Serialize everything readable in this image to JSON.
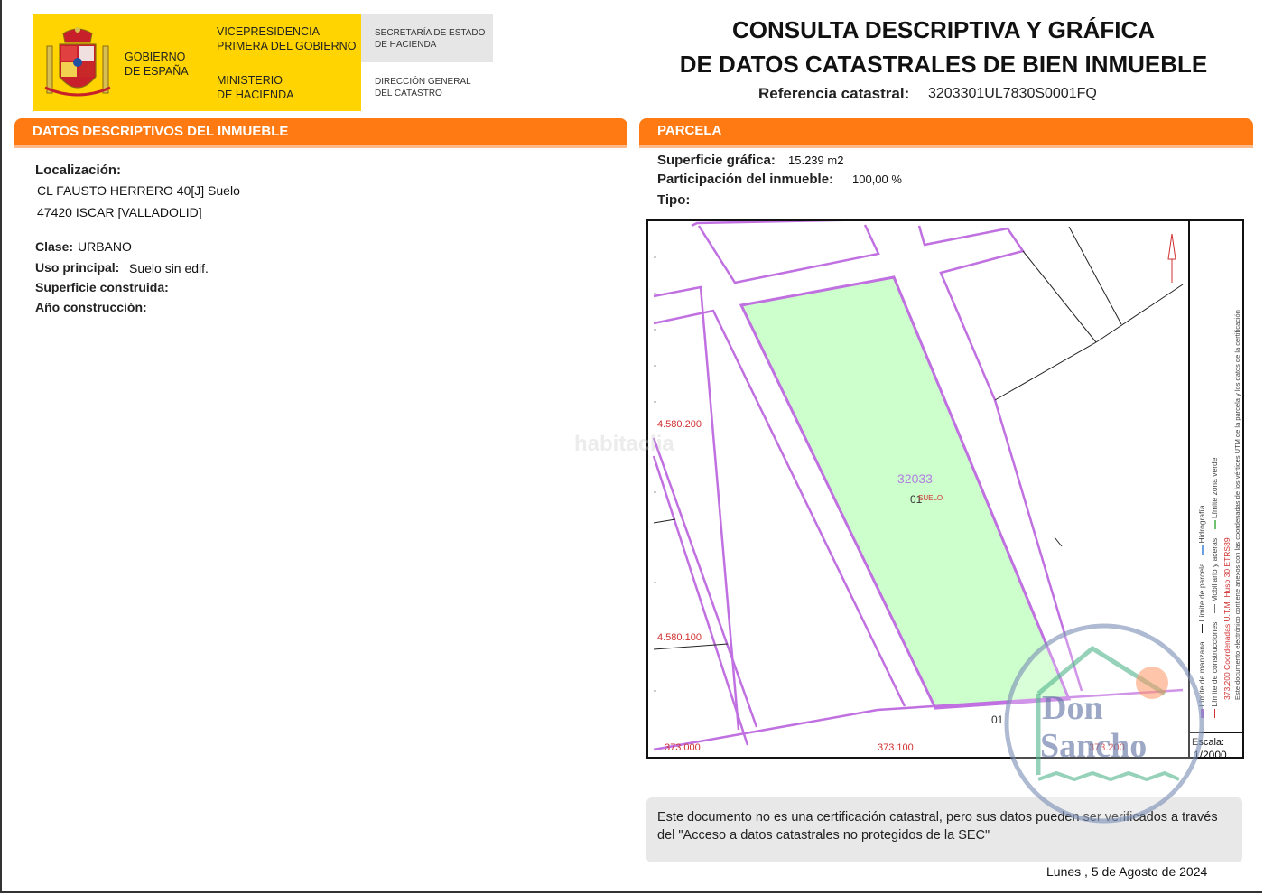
{
  "header": {
    "gov": [
      "GOBIERNO",
      "DE ESPAÑA"
    ],
    "vice": [
      "VICEPRESIDENCIA",
      "PRIMERA DEL GOBIERNO"
    ],
    "ministry": [
      "MINISTERIO",
      "DE HACIENDA"
    ],
    "secretaria": [
      "SECRETARÍA DE ESTADO",
      "DE HACIENDA"
    ],
    "direccion": [
      "DIRECCIÓN GENERAL",
      "DEL CATASTRO"
    ]
  },
  "title": {
    "line1": "CONSULTA DESCRIPTIVA Y GRÁFICA",
    "line2": "DE DATOS CATASTRALES DE BIEN INMUEBLE",
    "ref_label": "Referencia catastral:",
    "ref_value": "3203301UL7830S0001FQ"
  },
  "descriptive": {
    "header": "DATOS DESCRIPTIVOS DEL INMUEBLE",
    "localizacion_label": "Localización:",
    "address1": "CL FAUSTO HERRERO 40[J] Suelo",
    "address2": "47420 ISCAR [VALLADOLID]",
    "clase_label": "Clase:",
    "clase_value": "URBANO",
    "uso_label": "Uso principal:",
    "uso_value": "Suelo sin edif.",
    "superficie_label": "Superficie construida:",
    "anio_label": "Año construcción:"
  },
  "parcela": {
    "header": "PARCELA",
    "superficie_label": "Superficie gráfica:",
    "superficie_value": "15.239 m2",
    "participacion_label": "Participación del inmueble:",
    "participacion_value": "100,00 %",
    "tipo_label": "Tipo:"
  },
  "map": {
    "parcel_id": "32033",
    "unit_num": "01",
    "unit_label": "SUELO",
    "unit_num_bottom": "01",
    "coord_y1": "4.580.200",
    "coord_y2": "4.580.100",
    "coord_x1": "373.000",
    "coord_x2": "373.100",
    "coord_x3": "373.200",
    "scale_label": "Escala:",
    "scale_value": "1/2000",
    "legend1": "Límite de manzana",
    "legend2": "Límite de parcela",
    "legend3": "Hidrografía",
    "legend4": "Límite de construcciones",
    "legend5": "Mobiliario y aceras",
    "legend6": "Límite zona verde",
    "utm_note": "373.200 Coordenadas U.T.M. Huso 30 ETRS89",
    "vertex_note": "Este documento electrónico contiene anexos con las coordenadas de los vértices UTM de la parcela y los datos de la certificación",
    "colors": {
      "parcel_fill": "#ccffcc",
      "block_line": "#c070e0",
      "coord_text": "#d03030"
    }
  },
  "watermarks": {
    "habitaclia": "habitaclia",
    "brand1": "Don",
    "brand2": "Sancho"
  },
  "note": {
    "text": "Este documento no es una certificación catastral, pero sus datos pueden ser verificados a través del \"Acceso a datos catastrales no protegidos de la SEC\""
  },
  "date": "Lunes , 5 de Agosto de 2024"
}
